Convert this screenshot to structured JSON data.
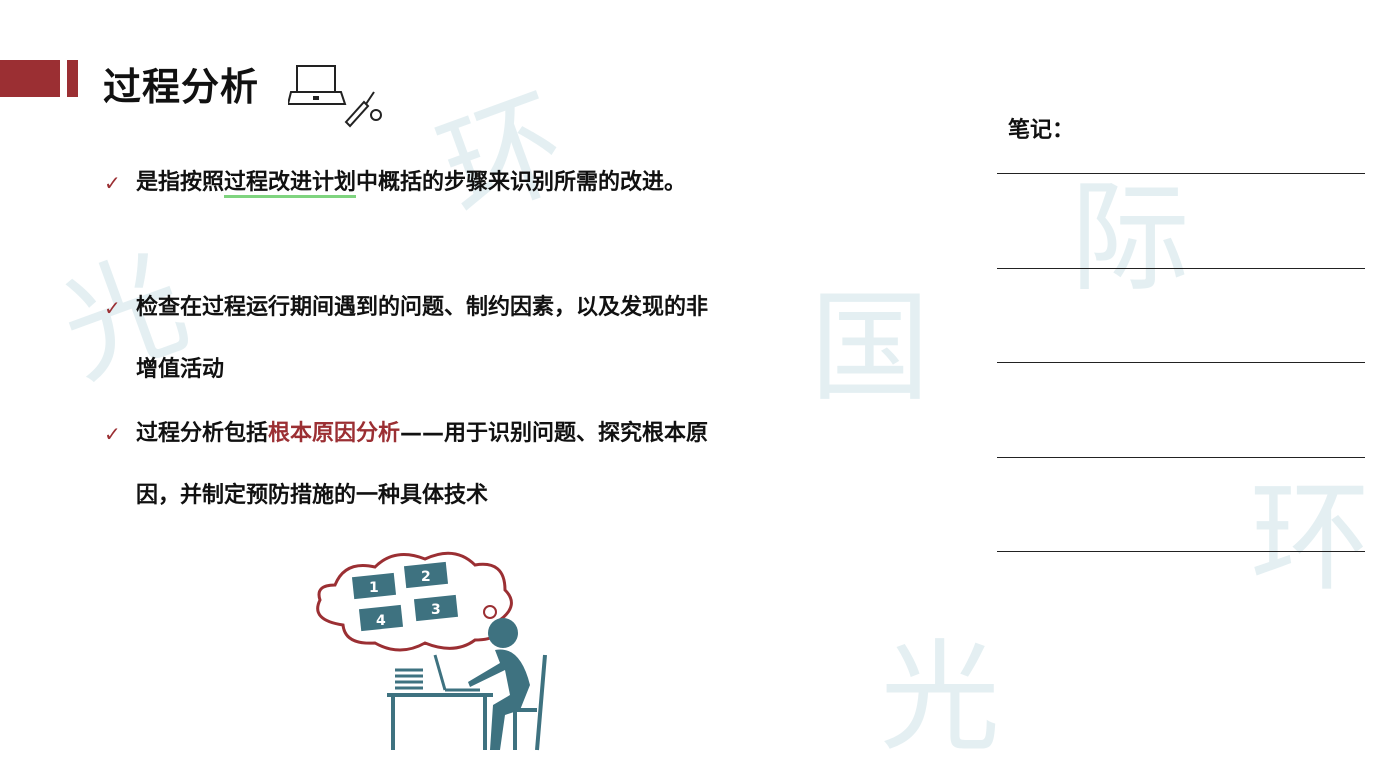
{
  "title": "过程分析",
  "bullets": [
    {
      "pre": "是指按照",
      "highlight": "过程改进计划",
      "post": "中概括的步骤来识别所需的改进。"
    },
    {
      "text": "检查在过程运行期间遇到的问题、制约因素，以及发现的非增值活动"
    },
    {
      "pre": "过程分析包括",
      "highlight": "根本原因分析",
      "post": "——用于识别问题、探究根本原因，并制定预防措施的一种具体技术"
    }
  ],
  "notes": {
    "label": "笔记："
  },
  "illustration": {
    "steps": [
      "1",
      "2",
      "3",
      "4"
    ]
  },
  "colors": {
    "accent": "#9b2f33",
    "figure": "#3e7280",
    "underline": "#7fd47f"
  }
}
